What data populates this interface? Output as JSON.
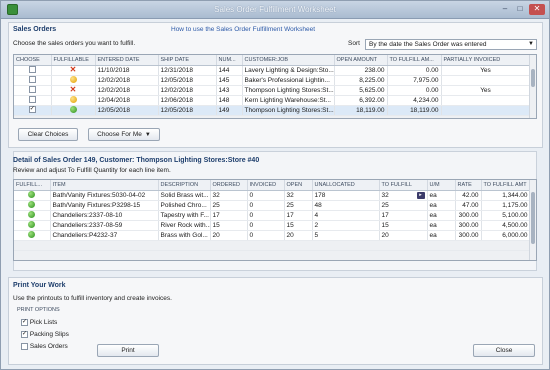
{
  "window": {
    "title": "Sales Order Fulfillment Worksheet",
    "min": "–",
    "max": "□",
    "close": "✕"
  },
  "orders_section": {
    "title": "Sales Orders",
    "help_link": "How to use the Sales Order Fulfillment Worksheet",
    "instruction": "Choose the sales orders you want to fulfill.",
    "sort_label": "Sort",
    "sort_value": "By the date the Sales Order was entered",
    "columns": [
      "CHOOSE",
      "FULFILLABLE",
      "ENTERED DATE",
      "SHIP DATE",
      "NUM...",
      "CUSTOMER:JOB",
      "OPEN AMOUNT",
      "TO FULFILL AM...",
      "PARTIALLY INVOICED"
    ],
    "rows": [
      {
        "checked": false,
        "status": "x",
        "entered": "11/10/2018",
        "ship": "12/31/2018",
        "num": "144",
        "customer": "Lavery Lighting & Design:Sto...",
        "open": "238.00",
        "to_fulfill": "0.00",
        "partial": "Yes"
      },
      {
        "checked": false,
        "status": "yellow",
        "entered": "12/02/2018",
        "ship": "12/05/2018",
        "num": "145",
        "customer": "Baker's Professional Lightin...",
        "open": "8,225.00",
        "to_fulfill": "7,975.00",
        "partial": ""
      },
      {
        "checked": false,
        "status": "x",
        "entered": "12/02/2018",
        "ship": "12/02/2018",
        "num": "143",
        "customer": "Thompson Lighting Stores:St...",
        "open": "5,625.00",
        "to_fulfill": "0.00",
        "partial": "Yes"
      },
      {
        "checked": false,
        "status": "yellow",
        "entered": "12/04/2018",
        "ship": "12/06/2018",
        "num": "148",
        "customer": "Kern Lighting Warehouse:St...",
        "open": "6,392.00",
        "to_fulfill": "4,234.00",
        "partial": ""
      },
      {
        "checked": true,
        "status": "green",
        "entered": "12/05/2018",
        "ship": "12/05/2018",
        "num": "149",
        "customer": "Thompson Lighting Stores:St...",
        "open": "18,119.00",
        "to_fulfill": "18,119.00",
        "partial": ""
      }
    ],
    "clear_button": "Clear Choices",
    "choose_button": "Choose For Me"
  },
  "detail_section": {
    "title": "Detail of Sales Order 149, Customer: Thompson Lighting Stores:Store #40",
    "instruction": "Review and adjust To Fulfill Quantity for each line item.",
    "columns": [
      "FULFILL...",
      "ITEM",
      "DESCRIPTION",
      "ORDERED",
      "INVOICED",
      "OPEN",
      "UNALLOCATED",
      "TO FULFILL",
      "U/M",
      "RATE",
      "TO FULFILL AMT"
    ],
    "rows": [
      {
        "status": "green",
        "item": "Bath/Vanity Fixtures:5030-04-02",
        "desc": "Solid Brass wit...",
        "ordered": "32",
        "invoiced": "0",
        "open": "32",
        "unalloc": "178",
        "to_fulfill": "32",
        "um": "ea",
        "rate": "42.00",
        "amount": "1,344.00"
      },
      {
        "status": "green",
        "item": "Bath/Vanity Fixtures:P3298-15",
        "desc": "Polished Chro...",
        "ordered": "25",
        "invoiced": "0",
        "open": "25",
        "unalloc": "48",
        "to_fulfill": "25",
        "um": "ea",
        "rate": "47.00",
        "amount": "1,175.00"
      },
      {
        "status": "green",
        "item": "Chandeliers:2337-08-10",
        "desc": "Tapestry with F...",
        "ordered": "17",
        "invoiced": "0",
        "open": "17",
        "unalloc": "4",
        "to_fulfill": "17",
        "um": "ea",
        "rate": "300.00",
        "amount": "5,100.00"
      },
      {
        "status": "green",
        "item": "Chandeliers:2337-08-59",
        "desc": "River Rock with...",
        "ordered": "15",
        "invoiced": "0",
        "open": "15",
        "unalloc": "2",
        "to_fulfill": "15",
        "um": "ea",
        "rate": "300.00",
        "amount": "4,500.00"
      },
      {
        "status": "green",
        "item": "Chandeliers:P4232-37",
        "desc": "Brass with Gol...",
        "ordered": "20",
        "invoiced": "0",
        "open": "20",
        "unalloc": "5",
        "to_fulfill": "20",
        "um": "ea",
        "rate": "300.00",
        "amount": "6,000.00"
      }
    ]
  },
  "print_section": {
    "title": "Print Your Work",
    "instruction": "Use the printouts to fulfill inventory and create invoices.",
    "options_title": "PRINT OPTIONS",
    "options": [
      {
        "label": "Pick Lists",
        "checked": true
      },
      {
        "label": "Packing Slips",
        "checked": true
      },
      {
        "label": "Sales Orders",
        "checked": false
      }
    ],
    "print_button": "Print",
    "close_button": "Close"
  }
}
